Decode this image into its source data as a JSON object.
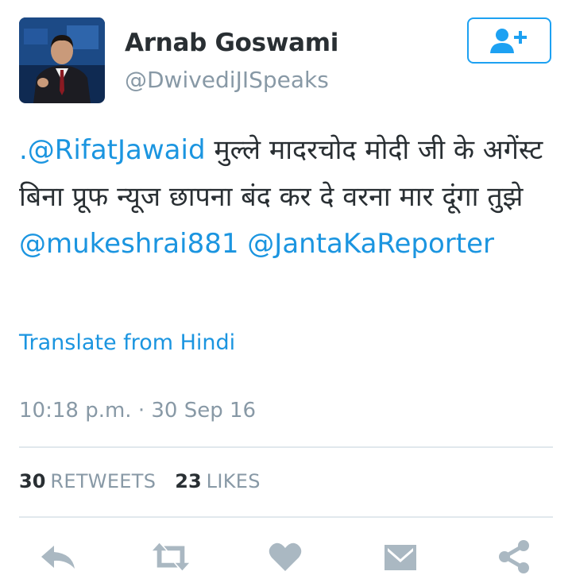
{
  "tweet": {
    "author": {
      "display_name": "Arnab Goswami",
      "handle": "@DwivediJISpeaks"
    },
    "follow_button": {
      "icon": "add-user-icon",
      "color": "#1da1f2"
    },
    "text_segments": [
      {
        "text": ".@RifatJawaid",
        "type": "mention"
      },
      {
        "text": "  मुल्ले मादरचोद मोदी जी के अगेंस्ट बिना प्रूफ न्यूज छापना बंद कर दे वरना मार दूंगा तुझे ",
        "type": "plain"
      },
      {
        "text": "@mukeshrai881",
        "type": "mention"
      },
      {
        "text": " ",
        "type": "plain"
      },
      {
        "text": "@JantaKaReporter",
        "type": "mention"
      }
    ],
    "translate_label": "Translate from Hindi",
    "timestamp": "10:18 p.m. · 30 Sep 16",
    "stats": {
      "retweets_count": "30",
      "retweets_label": "RETWEETS",
      "likes_count": "23",
      "likes_label": "LIKES"
    },
    "actions": [
      {
        "name": "reply-icon"
      },
      {
        "name": "retweet-icon"
      },
      {
        "name": "like-icon"
      },
      {
        "name": "message-icon"
      },
      {
        "name": "share-icon"
      }
    ],
    "colors": {
      "link": "#1b95e0",
      "muted": "#8899a6",
      "text": "#292f33",
      "divider": "#e1e8ed",
      "action_icon": "#aab8c2"
    }
  }
}
